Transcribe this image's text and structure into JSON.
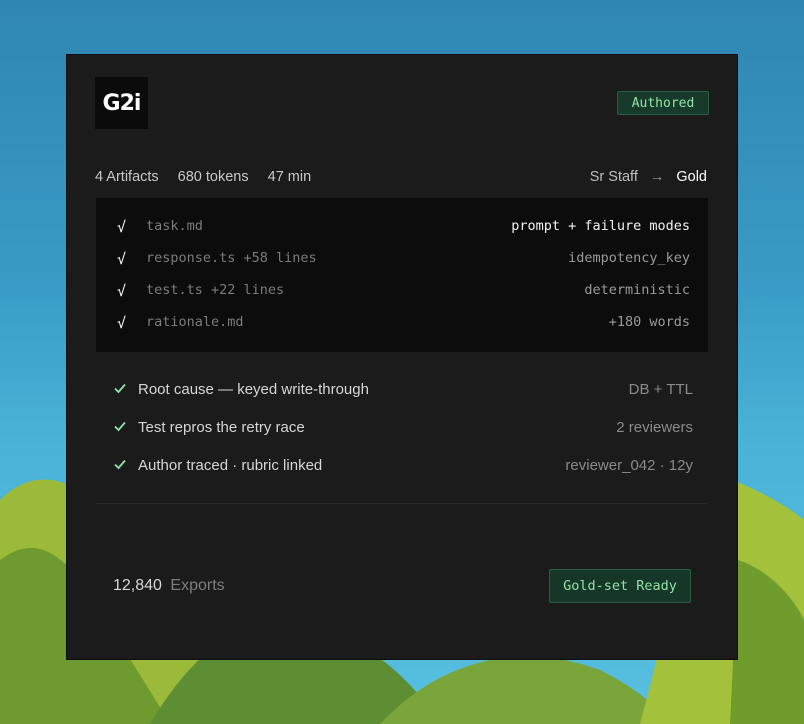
{
  "card": {
    "logo": "G2i",
    "status_badge": "Authored",
    "meta": {
      "artifacts": "4 Artifacts",
      "tokens": "680 tokens",
      "duration": "47 min"
    },
    "level": {
      "from": "Sr Staff",
      "arrow": "→",
      "to": "Gold"
    },
    "artifacts": [
      {
        "check": "√",
        "file": "task.md",
        "note": "prompt + failure modes"
      },
      {
        "check": "√",
        "file": "response.ts +58 lines",
        "note": "idempotency_key"
      },
      {
        "check": "√",
        "file": "test.ts +22 lines",
        "note": "deterministic"
      },
      {
        "check": "√",
        "file": "rationale.md",
        "note": "+180 words"
      }
    ],
    "checks": [
      {
        "label": "Root cause — keyed write-through",
        "value": "DB + TTL"
      },
      {
        "label": "Test repros the retry race",
        "value": "2 reviewers"
      },
      {
        "label": "Author traced · rubric linked",
        "value": "reviewer_042 · 12y"
      }
    ],
    "exports": {
      "count": "12,840",
      "label": "Exports"
    },
    "action_button": "Gold-set Ready"
  },
  "colors": {
    "accent_green": "#8fe3a6",
    "card_bg": "#1b1b1b",
    "panel_bg": "#0c0c0c"
  }
}
